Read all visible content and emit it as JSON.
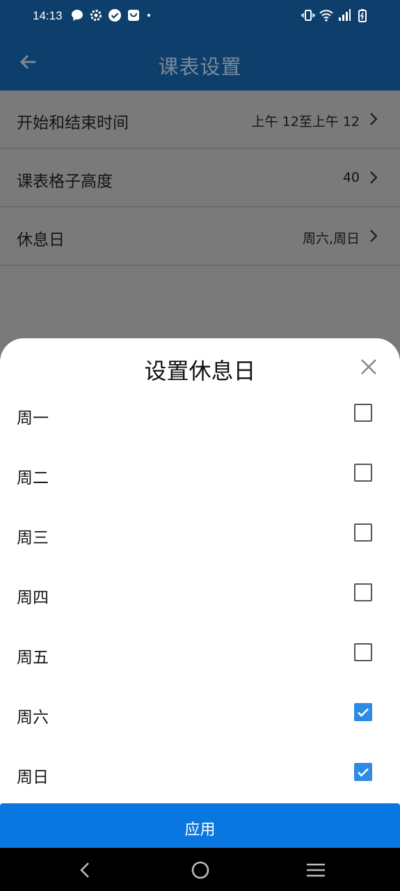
{
  "status_bar": {
    "time": "14:13",
    "left_icons": [
      "chat-bubble-icon",
      "gear-icon",
      "check-circle-icon",
      "bag-icon",
      "dot-icon"
    ],
    "right_icons": [
      "vibrate-icon",
      "wifi-icon",
      "signal-icon",
      "battery-charging-icon"
    ]
  },
  "app_bar": {
    "title": "课表设置",
    "back_icon": "arrow-left-icon",
    "background": "#0e3e6b"
  },
  "settings": [
    {
      "label": "开始和结束时间",
      "value": "上午 12至上午 12"
    },
    {
      "label": "课表格子高度",
      "value": "40"
    },
    {
      "label": "休息日",
      "value": "周六,周日"
    }
  ],
  "sheet": {
    "title": "设置休息日",
    "close_icon": "close-icon",
    "days": [
      {
        "label": "周一",
        "checked": false
      },
      {
        "label": "周二",
        "checked": false
      },
      {
        "label": "周三",
        "checked": false
      },
      {
        "label": "周四",
        "checked": false
      },
      {
        "label": "周五",
        "checked": false
      },
      {
        "label": "周六",
        "checked": true
      },
      {
        "label": "周日",
        "checked": true
      }
    ],
    "apply_label": "应用",
    "accent": "#0a76e0",
    "check_color": "#2d8be6"
  },
  "nav_bar": {
    "icons": [
      "nav-back-icon",
      "nav-home-icon",
      "nav-menu-icon"
    ]
  }
}
